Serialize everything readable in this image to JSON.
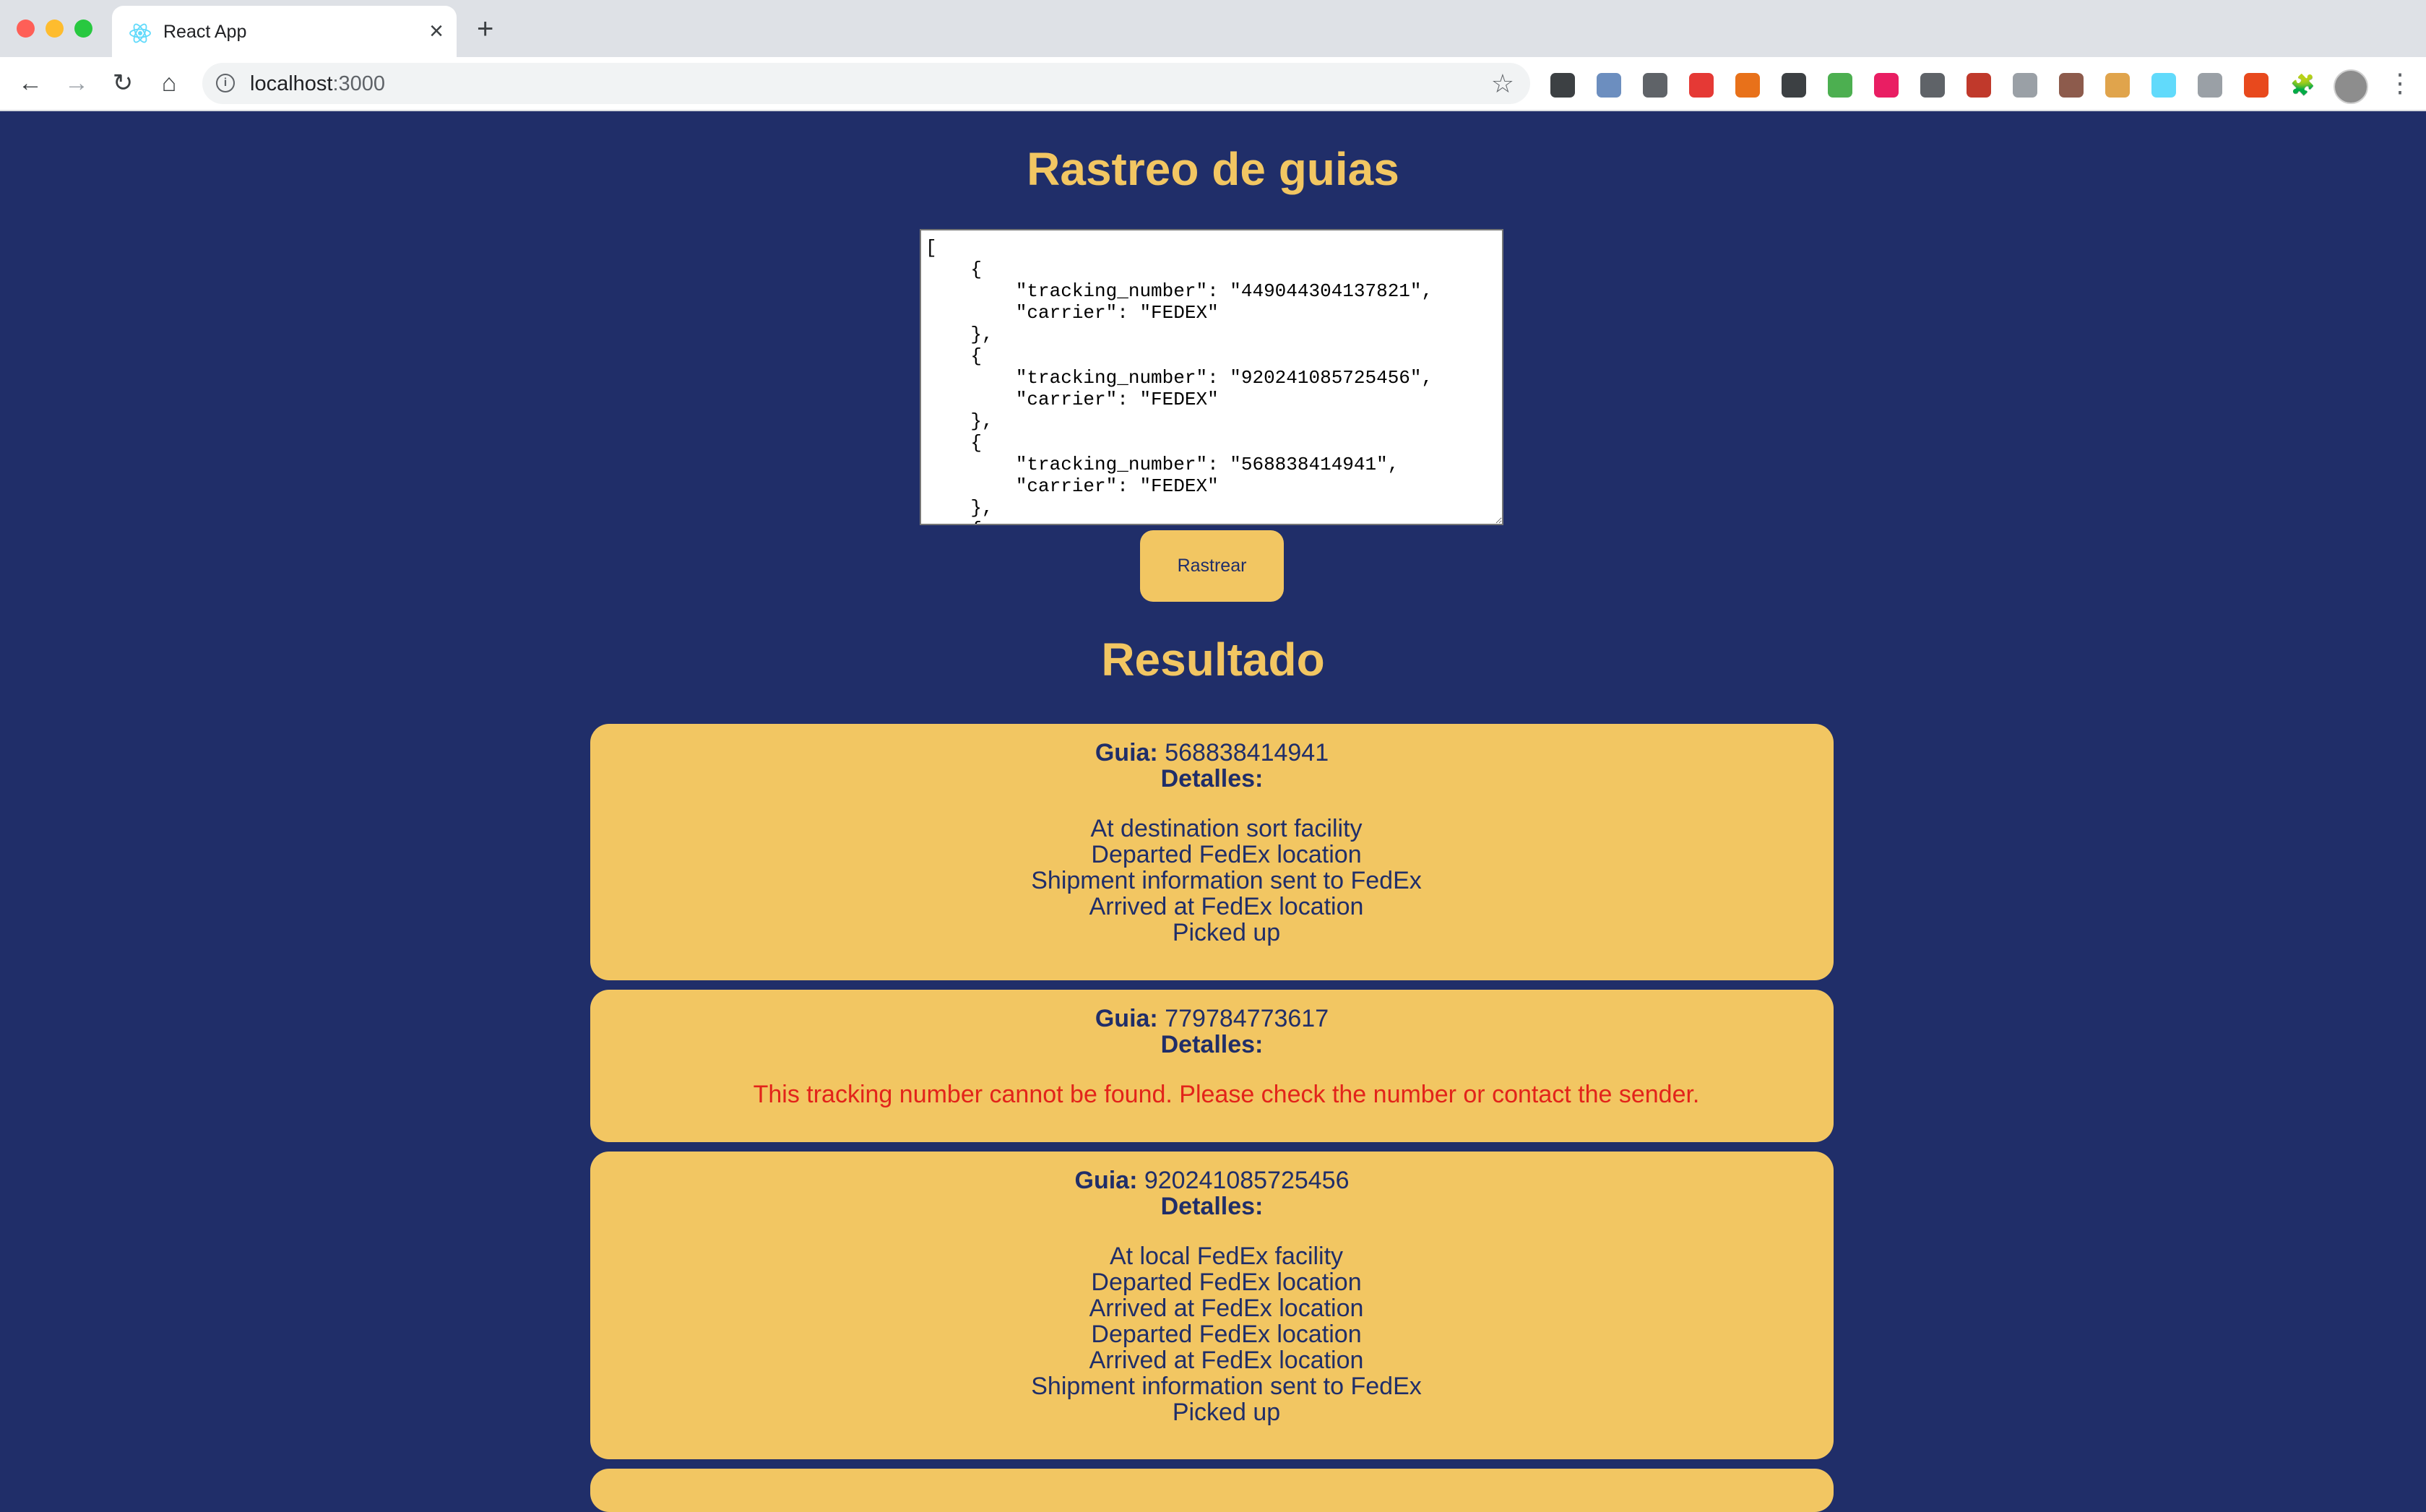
{
  "browser": {
    "tab_title": "React App",
    "url_host": "localhost",
    "url_port": ":3000",
    "extensions": [
      "downloads-icon",
      "extension-2-icon",
      "extension-3-icon",
      "adblock-icon",
      "download-icon",
      "medium-icon",
      "color-picker-icon",
      "extension-t-icon",
      "extension-9-icon",
      "extension-10-icon",
      "extension-11-icon",
      "extension-12-icon",
      "cookie-icon",
      "react-devtools-icon",
      "extension-15-icon",
      "extension-16-icon",
      "puzzle-icon"
    ]
  },
  "page": {
    "title": "Rastreo de guias",
    "input_value": "[\n    {\n        \"tracking_number\": \"449044304137821\",\n        \"carrier\": \"FEDEX\"\n    },\n    {\n        \"tracking_number\": \"920241085725456\",\n        \"carrier\": \"FEDEX\"\n    },\n    {\n        \"tracking_number\": \"568838414941\",\n        \"carrier\": \"FEDEX\"\n    },\n    {",
    "track_button_label": "Rastrear",
    "results_title": "Resultado"
  },
  "labels": {
    "guia": "Guia:",
    "detalles": "Detalles:"
  },
  "results": [
    {
      "guia": "568838414941",
      "events": [
        "At destination sort facility",
        "Departed FedEx location",
        "Shipment information sent to FedEx",
        "Arrived at FedEx location",
        "Picked up"
      ]
    },
    {
      "guia": "779784773617",
      "error": "This tracking number cannot be found. Please check the number or contact the sender."
    },
    {
      "guia": "920241085725456",
      "events": [
        "At local FedEx facility",
        "Departed FedEx location",
        "Arrived at FedEx location",
        "Departed FedEx location",
        "Arrived at FedEx location",
        "Shipment information sent to FedEx",
        "Picked up"
      ]
    }
  ],
  "colors": {
    "background": "#202e69",
    "accent": "#f2c662",
    "error": "#e2231a"
  }
}
